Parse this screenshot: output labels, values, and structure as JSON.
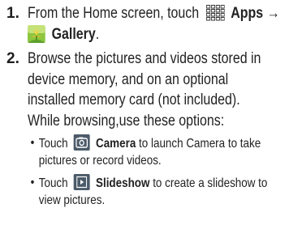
{
  "step1": {
    "number": "1.",
    "text_pre": "From the Home screen, touch",
    "apps_label": "Apps",
    "arrow": "→",
    "gallery_label": "Gallery",
    "period": "."
  },
  "step2": {
    "number": "2.",
    "lines": [
      "Browse the pictures and videos stored in",
      "device memory, and on an optional",
      "installed memory card (not included).",
      "While browsing,use these options:"
    ],
    "bullets": [
      {
        "dot": "•",
        "pre": "Touch",
        "icon": "camera-icon",
        "bold": "Camera",
        "after": "to launch Camera to take",
        "cont": "pictures or record videos."
      },
      {
        "dot": "•",
        "pre": "Touch",
        "icon": "slideshow-play-icon",
        "bold": "Slideshow",
        "after": "to create a slideshow to",
        "cont": "view pictures."
      }
    ]
  },
  "colors": {
    "icon_dark": "#333333",
    "icon_blue_gray": "#4c5b6a",
    "gallery_green": "#7fb33a"
  }
}
